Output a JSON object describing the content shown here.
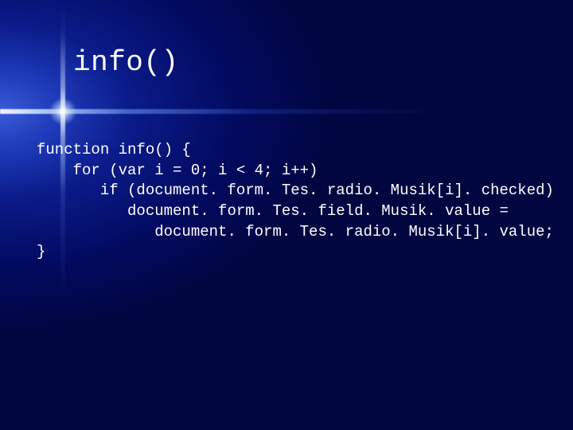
{
  "title": "info()",
  "code": {
    "l1": "function info() {",
    "l2": "    for (var i = 0; i < 4; i++)",
    "l3": "       if (document. form. Tes. radio. Musik[i]. checked)",
    "l4": "          document. form. Tes. field. Musik. value =",
    "l5": "             document. form. Tes. radio. Musik[i]. value;",
    "l6": "}"
  }
}
